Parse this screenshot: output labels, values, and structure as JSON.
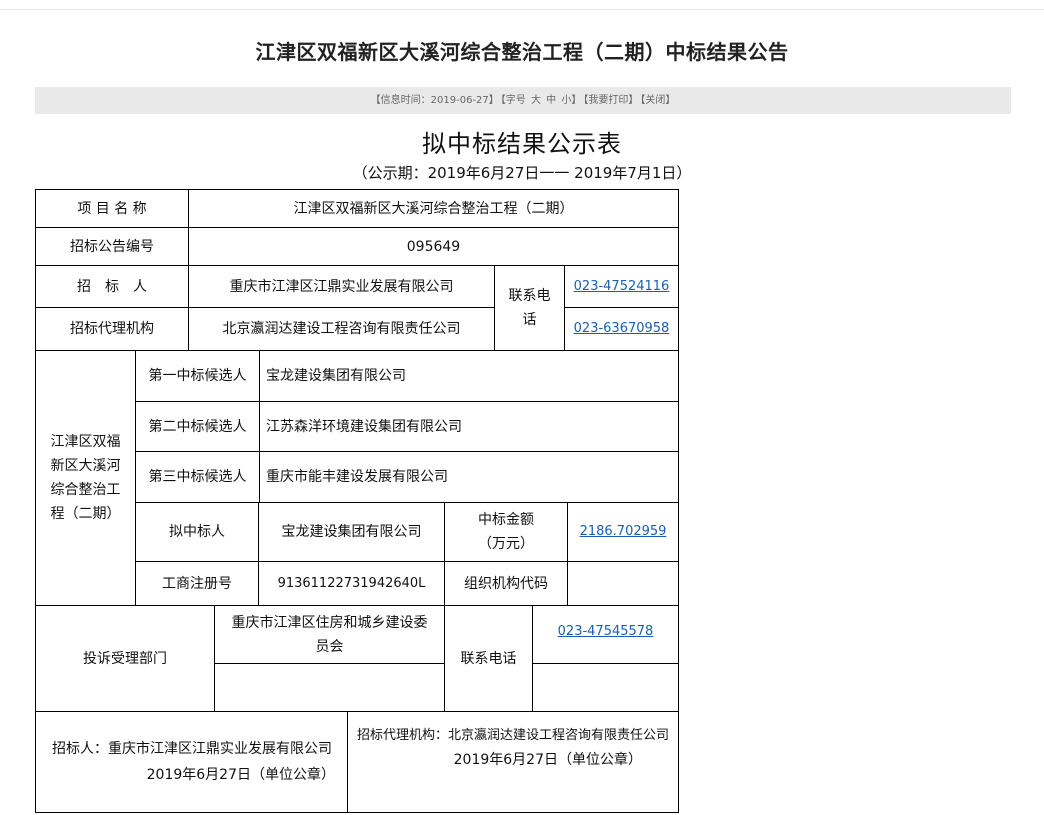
{
  "page": {
    "title": "江津区双福新区大溪河综合整治工程（二期）中标结果公告",
    "info_bar": {
      "info_time": "【信息时间：2019-06-27】",
      "font_size_prefix": "【字号",
      "size_large": "大",
      "size_medium": "中",
      "size_small": "小】",
      "print": "【我要打印】",
      "close": "【关闭】"
    },
    "subtitle": "拟中标结果公示表",
    "period": "（公示期：2019年6月27日一一 2019年7月1日）"
  },
  "table": {
    "project_name_label": "项 目 名 称",
    "project_name": "江津区双福新区大溪河综合整治工程（二期）",
    "notice_no_label": "招标公告编号",
    "notice_no": "095649",
    "tenderer_label": "招　标　人",
    "tenderer": "重庆市江津区江鼎实业发展有限公司",
    "contact_phone_label": "联系电话",
    "tenderer_phone": "023-47524116",
    "agency_label": "招标代理机构",
    "agency": "北京瀛润达建设工程咨询有限责任公司",
    "agency_phone": "023-63670958",
    "section_label": "江津区双福新区大溪河综合整治工程（二期）",
    "candidates": [
      {
        "label": "第一中标候选人",
        "name": "宝龙建设集团有限公司"
      },
      {
        "label": "第二中标候选人",
        "name": "江苏森洋环境建设集团有限公司"
      },
      {
        "label": "第三中标候选人",
        "name": "重庆市能丰建设发展有限公司"
      }
    ],
    "winner_label": "拟中标人",
    "winner": "宝龙建设集团有限公司",
    "amount_label": "中标金额（万元）",
    "amount": "2186.702959",
    "reg_no_label": "工商注册号",
    "reg_no": "91361122731942640L",
    "org_code_label": "组织机构代码",
    "org_code": "",
    "complaint_label": "投诉受理部门",
    "complaint_dept": "重庆市江津区住房和城乡建设委员会",
    "complaint_phone_label": "联系电话",
    "complaint_phone": "023-47545578",
    "footer_tenderer": "招标人：重庆市江津区江鼎实业发展有限公司",
    "footer_tenderer_date": "2019年6月27日（单位公章）",
    "footer_agency": "招标代理机构：北京瀛润达建设工程咨询有限责任公司",
    "footer_agency_date": "2019年6月27日（单位公章）"
  }
}
